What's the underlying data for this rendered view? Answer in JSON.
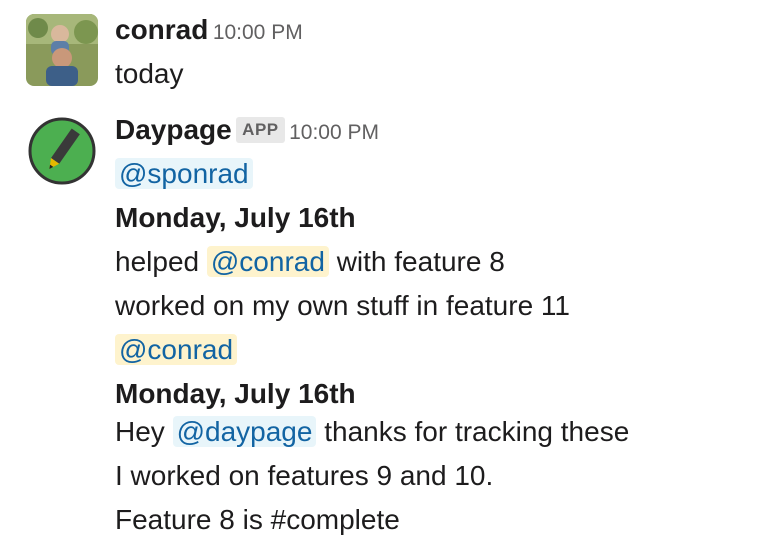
{
  "messages": [
    {
      "author": "conrad",
      "time": "10:00 PM",
      "text": "today"
    },
    {
      "author": "Daypage",
      "badge": "APP",
      "time": "10:00 PM",
      "lines": {
        "m1": "@sponrad",
        "h1": "Monday, July 16th",
        "l1a": "helped",
        "l1m": "@conrad",
        "l1b": "with feature 8",
        "l2": "worked on my own stuff in feature 11",
        "m2": "@conrad",
        "h2": "Monday, July 16th",
        "l3a": "Hey",
        "l3m": "@daypage",
        "l3b": "thanks for tracking these",
        "l4": "I worked on features 9 and 10.",
        "l5": "Feature 8 is #complete"
      }
    }
  ],
  "colors": {
    "mention": "#1264a3",
    "mention_bg": "#e8f5fa",
    "self_mention_bg": "#fef3cd",
    "app_icon_green": "#4caf50"
  },
  "icons": {
    "user_avatar": "user-avatar-photo",
    "app_avatar": "pencil-icon"
  }
}
